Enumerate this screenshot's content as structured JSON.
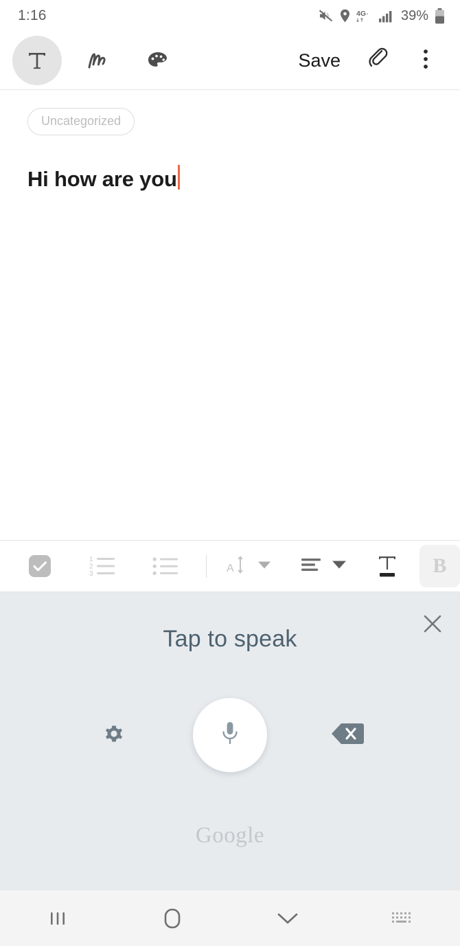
{
  "status_bar": {
    "time": "1:16",
    "battery_percent": "39%",
    "icons": [
      "mute-icon",
      "location-icon",
      "network-4g-icon",
      "signal-bars-icon",
      "battery-icon"
    ]
  },
  "app_bar": {
    "modes": [
      {
        "name": "text-mode",
        "icon": "text-T-icon",
        "selected": true
      },
      {
        "name": "handwriting-mode",
        "icon": "handwriting-icon",
        "selected": false
      },
      {
        "name": "drawing-mode",
        "icon": "palette-icon",
        "selected": false
      }
    ],
    "save_label": "Save",
    "attach_icon": "paperclip-icon",
    "more_icon": "more-vertical-icon"
  },
  "note": {
    "category": "Uncategorized",
    "body_text": "Hi how are you",
    "caret_color": "#e8694a"
  },
  "format_bar": {
    "items": [
      {
        "name": "checklist-button",
        "icon": "checkbox-checked-icon"
      },
      {
        "name": "numbered-list-button",
        "icon": "numbered-list-icon"
      },
      {
        "name": "bulleted-list-button",
        "icon": "bulleted-list-icon"
      },
      {
        "name": "font-size-button",
        "icon": "font-size-icon"
      },
      {
        "name": "font-size-dropdown",
        "icon": "chevron-down-icon"
      },
      {
        "name": "alignment-button",
        "icon": "align-left-icon"
      },
      {
        "name": "alignment-dropdown",
        "icon": "chevron-down-icon"
      },
      {
        "name": "text-color-button",
        "icon": "text-color-icon"
      },
      {
        "name": "bold-button",
        "icon": "bold-B-icon"
      }
    ],
    "bold_label": "B",
    "numbered_list_digits": [
      "1",
      "2",
      "3"
    ]
  },
  "voice_panel": {
    "title": "Tap to speak",
    "brand": "Google",
    "close_icon": "close-icon",
    "settings_icon": "gear-icon",
    "mic_icon": "microphone-icon",
    "backspace_icon": "backspace-icon",
    "background_color": "#e8ebee",
    "title_color": "#4e6270"
  },
  "nav_bar": {
    "items": [
      {
        "name": "nav-recents-button",
        "icon": "recents-icon"
      },
      {
        "name": "nav-home-button",
        "icon": "home-icon"
      },
      {
        "name": "nav-hide-keyboard-button",
        "icon": "chevron-down-icon"
      },
      {
        "name": "nav-keyboard-switch-button",
        "icon": "keyboard-icon"
      }
    ]
  }
}
